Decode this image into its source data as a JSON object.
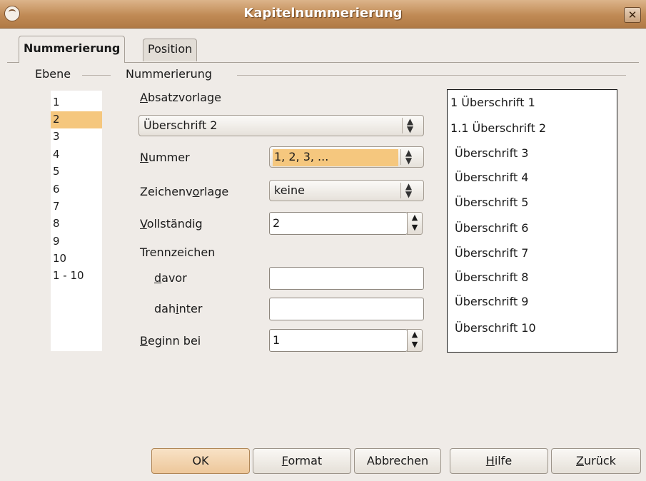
{
  "window": {
    "title": "Kapitelnummerierung",
    "close_glyph": "✕"
  },
  "tabs": [
    {
      "label": "Nummerierung",
      "active": true
    },
    {
      "label": "Position",
      "active": false
    }
  ],
  "groups": {
    "level": "Ebene",
    "numbering": "Nummerierung"
  },
  "levels": [
    "1",
    "2",
    "3",
    "4",
    "5",
    "6",
    "7",
    "8",
    "9",
    "10",
    "1 - 10"
  ],
  "selected_level": "2",
  "form": {
    "paragraph_style": {
      "label_mnemonic": "A",
      "label_rest": "bsatzvorlage",
      "value": "Überschrift 2"
    },
    "number": {
      "label_mnemonic": "N",
      "label_rest": "ummer",
      "value": "1, 2, 3, ..."
    },
    "char_style": {
      "label_pre": "Zeichenv",
      "label_mnemonic": "o",
      "label_rest": "rlage",
      "value": "keine"
    },
    "complete": {
      "label_mnemonic": "V",
      "label_rest": "ollständig",
      "value": "2"
    },
    "separator": {
      "label": "Trennzeichen"
    },
    "before": {
      "label_mnemonic": "d",
      "label_rest": "avor",
      "value": ""
    },
    "after": {
      "label_pre": "dah",
      "label_mnemonic": "i",
      "label_rest": "nter",
      "value": ""
    },
    "start_at": {
      "label_mnemonic": "B",
      "label_rest": "eginn bei",
      "value": "1"
    }
  },
  "preview": [
    "1  Überschrift 1",
    "1.1  Überschrift 2",
    "Überschrift 3",
    "Überschrift 4",
    "Überschrift 5",
    "Überschrift 6",
    "Überschrift 7",
    "Überschrift 8",
    "Überschrift 9",
    "Überschrift 10"
  ],
  "buttons": {
    "ok": "OK",
    "format": {
      "mnemonic": "F",
      "rest": "ormat"
    },
    "cancel": "Abbrechen",
    "help": {
      "mnemonic": "H",
      "rest": "ilfe"
    },
    "back": {
      "mnemonic": "Z",
      "rest": "urück"
    }
  }
}
